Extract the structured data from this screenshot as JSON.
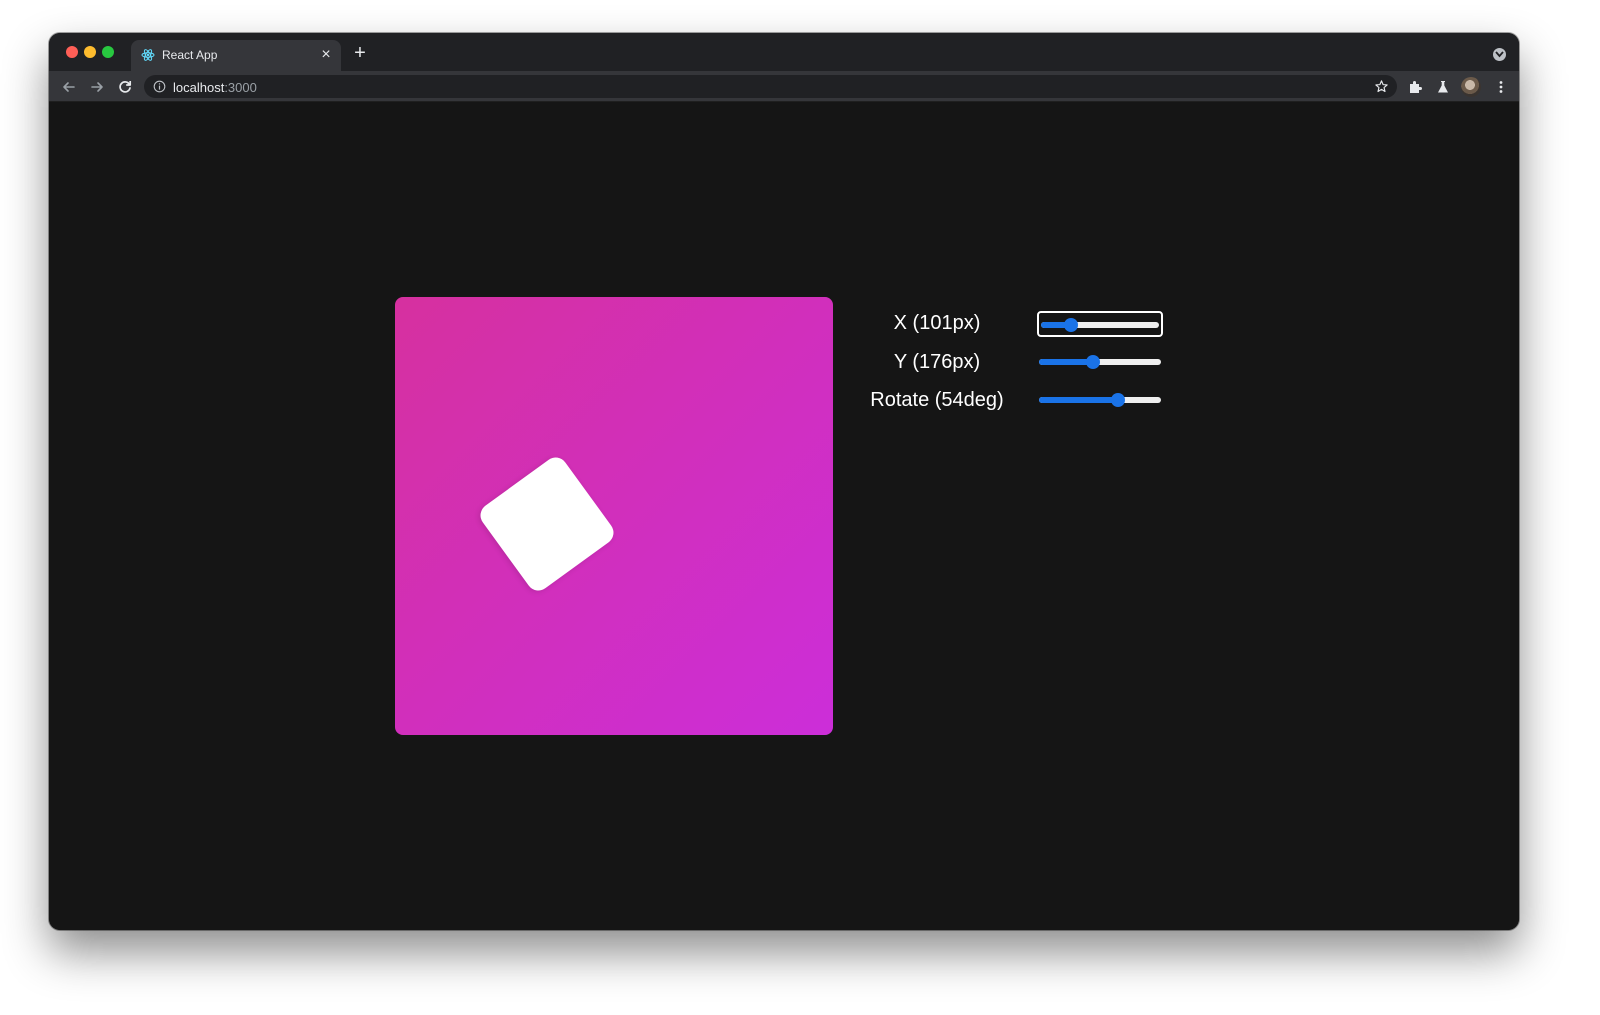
{
  "browser": {
    "tab_title": "React App",
    "tab_close": "×",
    "new_tab": "+",
    "url_host": "localhost",
    "url_path": ":3000"
  },
  "app": {
    "box_gradient": [
      "#d6309f",
      "#cc2ed9"
    ],
    "square_color": "#ffffff",
    "accent": "#1a73e8",
    "controls": [
      {
        "id": "x",
        "label": "X (101px)",
        "value": 101,
        "min": 0,
        "max": 400,
        "unit": "px"
      },
      {
        "id": "y",
        "label": "Y (176px)",
        "value": 176,
        "min": 0,
        "max": 400,
        "unit": "px"
      },
      {
        "id": "rotate",
        "label": "Rotate (54deg)",
        "value": 54,
        "min": -180,
        "max": 180,
        "unit": "deg"
      }
    ]
  }
}
